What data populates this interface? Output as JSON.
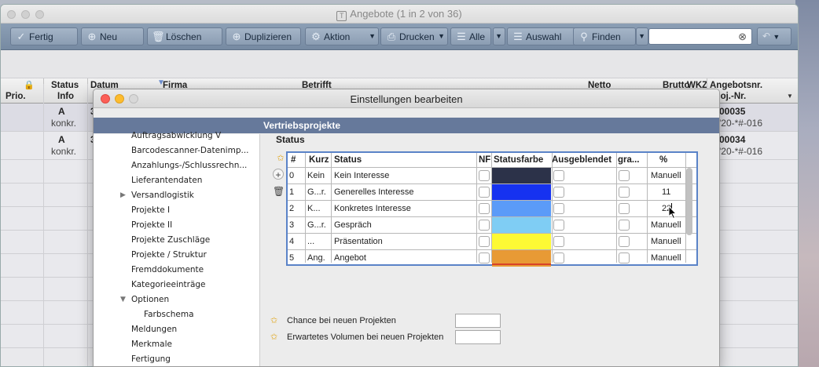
{
  "main_window": {
    "title": "Angebote (1 in 2 von 36)",
    "toolbar": {
      "fertig": "Fertig",
      "neu": "Neu",
      "loeschen": "Löschen",
      "duplizieren": "Duplizieren",
      "aktion": "Aktion",
      "drucken": "Drucken",
      "alle": "Alle",
      "auswahl": "Auswahl",
      "finden": "Finden",
      "search_value": ""
    },
    "columns": {
      "prio": "Prio.",
      "status": "Status",
      "info": "Info",
      "datum": "Datum",
      "firma": "Firma",
      "betrifft": "Betrifft",
      "netto": "Netto",
      "brutto": "Brutto",
      "wkz": "WKZ",
      "angebotsnr": "Angebotsnr.",
      "projnr": "...oj.-Nr."
    },
    "rows": [
      {
        "status": "A",
        "info": "konkr.",
        "datum_partial": "3",
        "angebotsnr": "00035",
        "projnr": "'20-*#-016"
      },
      {
        "status": "A",
        "info": "konkr.",
        "datum_partial": "3",
        "angebotsnr": "00034",
        "projnr": "'20-*#-016"
      }
    ]
  },
  "dialog": {
    "title": "Einstellungen bearbeiten",
    "section": "Vertriebsprojekte",
    "nav": [
      {
        "label": "Auftragsabwicklung V"
      },
      {
        "label": "Barcodescanner-Datenimp..."
      },
      {
        "label": "Anzahlungs-/Schlussrechn..."
      },
      {
        "label": "Lieferantendaten"
      },
      {
        "label": "Versandlogistik",
        "collapsed": true
      },
      {
        "label": "Projekte I"
      },
      {
        "label": "Projekte II"
      },
      {
        "label": "Projekte Zuschläge"
      },
      {
        "label": "Projekte / Struktur"
      },
      {
        "label": "Fremddokumente"
      },
      {
        "label": "Kategorieeinträge"
      },
      {
        "label": "Optionen",
        "expanded": true
      },
      {
        "label": "Farbschema",
        "child": true
      },
      {
        "label": "Meldungen"
      },
      {
        "label": "Merkmale"
      },
      {
        "label": "Fertigung"
      }
    ],
    "status_label": "Status",
    "table": {
      "headers": {
        "num": "#",
        "kurz": "Kurz",
        "status": "Status",
        "nf": "NF",
        "farbe": "Statusfarbe",
        "ausgeblendet": "Ausgeblendet",
        "gra": "gra...",
        "pct": "%"
      },
      "rows": [
        {
          "num": "0",
          "kurz": "Kein",
          "status": "Kein Interesse",
          "color": "#2c3249",
          "pct": "Manuell"
        },
        {
          "num": "1",
          "kurz": "G...r.",
          "status": "Generelles Interesse",
          "color": "#1632f0",
          "pct": "11"
        },
        {
          "num": "2",
          "kurz": "K...",
          "status": "Konkretes Interesse",
          "color": "#5b9bf8",
          "pct": "22"
        },
        {
          "num": "3",
          "kurz": "G...r.",
          "status": "Gespräch",
          "color": "#7fcdf4",
          "pct": "Manuell"
        },
        {
          "num": "4",
          "kurz": "...",
          "status": "Präsentation",
          "color": "#fdf934",
          "pct": "Manuell"
        },
        {
          "num": "5",
          "kurz": "Ang.",
          "status": "Angebot",
          "color": "#e89a35",
          "pct": "Manuell"
        }
      ]
    },
    "chance_label": "Chance bei neuen Projekten",
    "volumen_label": "Erwartetes Volumen bei neuen Projekten"
  }
}
